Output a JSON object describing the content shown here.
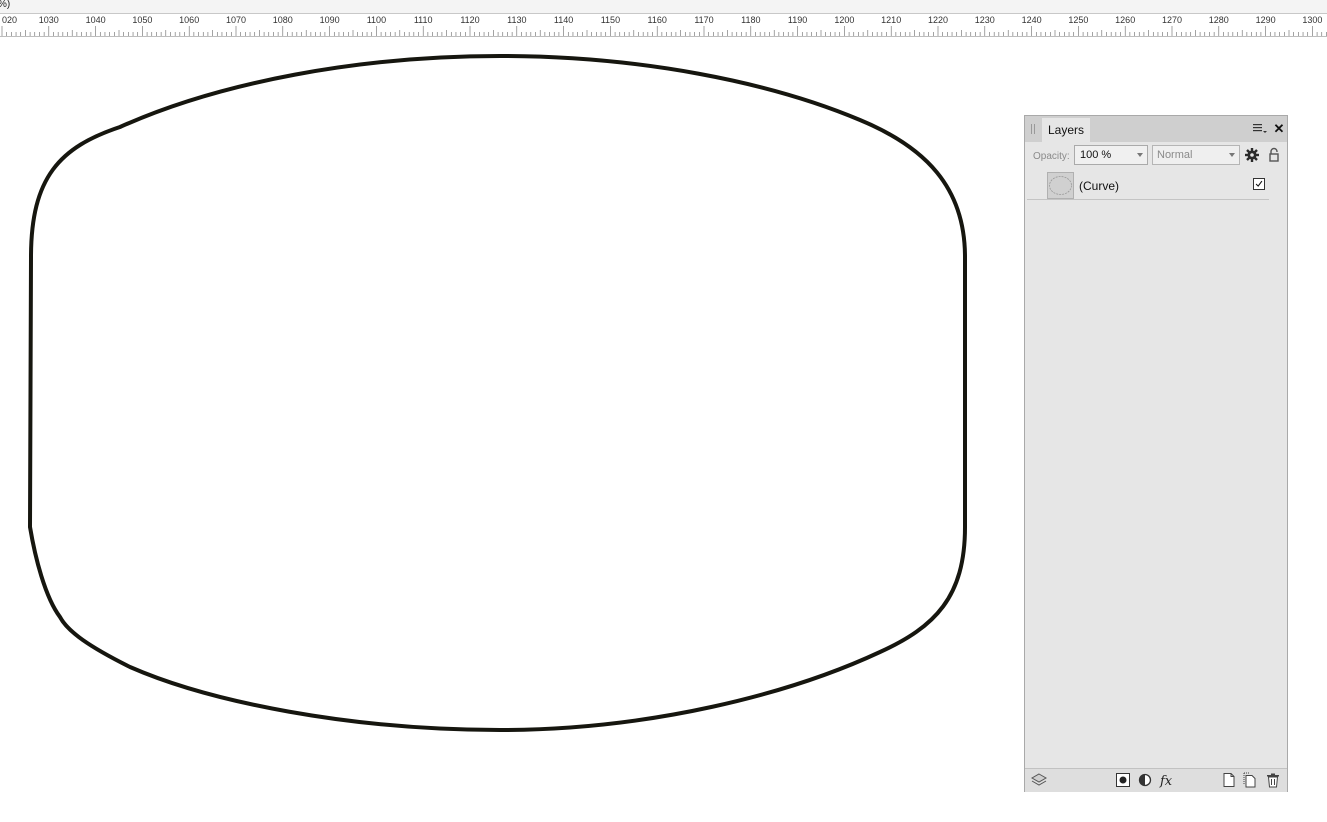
{
  "window": {
    "top_fragment": "%)"
  },
  "ruler": {
    "labels": [
      "020",
      "1030",
      "1040",
      "1050",
      "1060",
      "1070",
      "1080",
      "1090",
      "1100",
      "1110",
      "1120",
      "1130",
      "1140",
      "1150",
      "1160",
      "1170",
      "1180",
      "1190",
      "1200",
      "1210",
      "1220",
      "1230",
      "1240",
      "1250",
      "1260",
      "1270",
      "1280",
      "1290",
      "1300"
    ]
  },
  "layers_panel": {
    "tab_label": "Layers",
    "opacity_label": "Opacity:",
    "opacity_value": "100 %",
    "blend_mode": "Normal",
    "layers": [
      {
        "name": "(Curve)",
        "visible": true
      }
    ]
  },
  "colors": {
    "curve_stroke": "#16160f",
    "panel_bg": "#e6e6e6",
    "panel_header": "#cfcfcf"
  }
}
